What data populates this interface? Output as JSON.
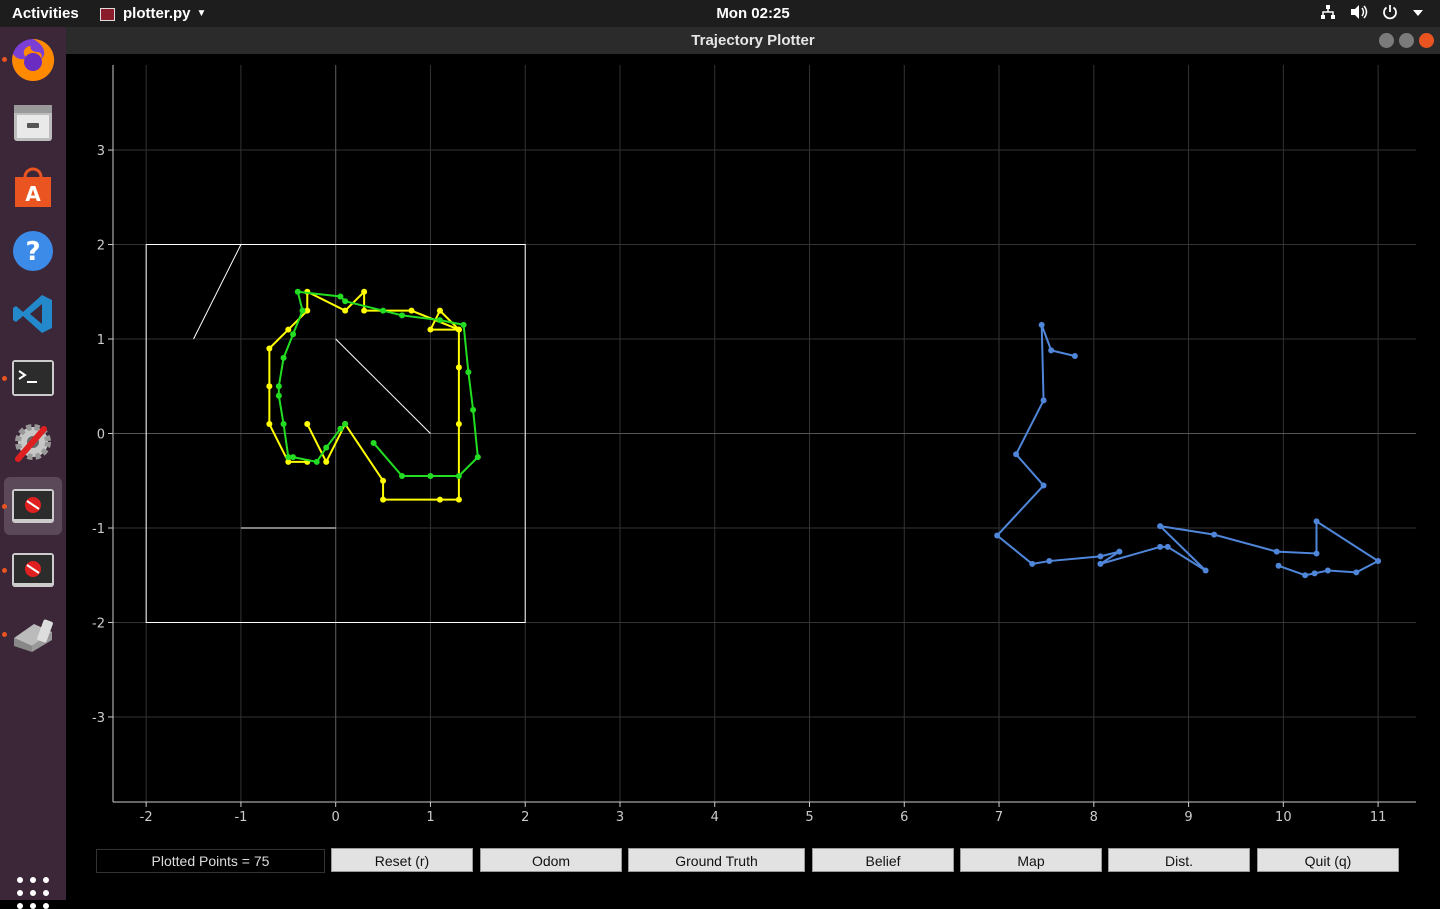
{
  "topbar": {
    "activities": "Activities",
    "app_name": "plotter.py",
    "clock": "Mon 02:25"
  },
  "dock": {
    "items": [
      {
        "name": "firefox-icon",
        "running": true
      },
      {
        "name": "files-icon",
        "running": false
      },
      {
        "name": "software-center-icon",
        "running": false
      },
      {
        "name": "help-icon",
        "running": false
      },
      {
        "name": "vscode-icon",
        "running": false
      },
      {
        "name": "terminal-icon",
        "running": true
      },
      {
        "name": "system-tools-icon",
        "running": false
      },
      {
        "name": "plotter-window-icon",
        "running": true,
        "active": true
      },
      {
        "name": "plotter-window-2-icon",
        "running": true
      },
      {
        "name": "scanner-icon",
        "running": true
      }
    ]
  },
  "window": {
    "title": "Trajectory Plotter"
  },
  "status": {
    "plotted_points": "Plotted Points = 75"
  },
  "buttons": {
    "reset": "Reset (r)",
    "odom": "Odom",
    "ground_truth": "Ground Truth",
    "belief": "Belief",
    "map": "Map",
    "dist": "Dist.",
    "quit": "Quit (q)"
  },
  "chart_data": {
    "type": "line",
    "title": "",
    "xlabel": "",
    "ylabel": "",
    "xlim": [
      -2.35,
      11.4
    ],
    "ylim": [
      -3.9,
      3.9
    ],
    "x_ticks": [
      -2,
      -1,
      0,
      1,
      2,
      3,
      4,
      5,
      6,
      7,
      8,
      9,
      10,
      11
    ],
    "y_ticks": [
      -3,
      -2,
      -1,
      0,
      1,
      2,
      3
    ],
    "grid": true,
    "colors": {
      "map": "#ffffff",
      "yellow": "#ffff00",
      "green": "#22dd22",
      "blue": "#4f86d9",
      "grid": "#333333"
    },
    "map_box": {
      "x": [
        -2,
        2,
        2,
        -2,
        -2
      ],
      "y": [
        2,
        2,
        -2,
        -2,
        2
      ]
    },
    "map_lines": [
      {
        "x": [
          -1.5,
          -1.0
        ],
        "y": [
          1.0,
          2.0
        ]
      },
      {
        "x": [
          0,
          1.0
        ],
        "y": [
          1.0,
          0.0
        ]
      },
      {
        "x": [
          -1.0,
          0
        ],
        "y": [
          -1.0,
          -1.0
        ]
      }
    ],
    "series": [
      {
        "color": "yellow",
        "x": [
          -0.3,
          -0.1,
          0.1,
          0.5,
          0.5,
          1.1,
          1.3,
          1.3,
          1.3,
          1.3,
          1.1,
          1.0,
          1.3,
          0.8,
          0.3,
          0.3,
          0.1,
          -0.3,
          -0.3,
          -0.5,
          -0.7,
          -0.7,
          -0.7,
          -0.5,
          -0.3
        ],
        "y": [
          0.1,
          -0.3,
          0.1,
          -0.5,
          -0.7,
          -0.7,
          -0.7,
          0.1,
          0.7,
          1.1,
          1.3,
          1.1,
          1.1,
          1.3,
          1.3,
          1.5,
          1.3,
          1.5,
          1.3,
          1.1,
          0.9,
          0.5,
          0.1,
          -0.3,
          -0.3
        ]
      },
      {
        "color": "green",
        "x": [
          0.4,
          0.7,
          1.0,
          1.3,
          1.5,
          1.45,
          1.4,
          1.35,
          1.1,
          0.7,
          0.5,
          0.1,
          0.05,
          -0.4,
          -0.35,
          -0.45,
          -0.55,
          -0.6,
          -0.6,
          -0.55,
          -0.5,
          -0.45,
          -0.2,
          -0.1,
          0.05,
          0.1
        ],
        "y": [
          -0.1,
          -0.45,
          -0.45,
          -0.45,
          -0.25,
          0.25,
          0.65,
          1.15,
          1.2,
          1.25,
          1.3,
          1.4,
          1.45,
          1.5,
          1.3,
          1.05,
          0.8,
          0.5,
          0.4,
          0.1,
          -0.25,
          -0.25,
          -0.3,
          -0.15,
          0.05,
          0.1
        ]
      },
      {
        "color": "blue",
        "x": [
          7.8,
          7.55,
          7.45,
          7.47,
          7.18,
          7.47,
          6.98,
          7.35,
          7.53,
          8.07,
          8.27,
          8.07,
          8.7,
          8.78,
          9.18,
          8.7,
          9.27,
          9.93,
          10.35,
          10.35,
          11.0,
          10.77,
          10.47,
          10.33,
          10.23,
          9.95
        ],
        "y": [
          0.82,
          0.88,
          1.15,
          0.35,
          -0.22,
          -0.55,
          -1.08,
          -1.38,
          -1.35,
          -1.3,
          -1.25,
          -1.38,
          -1.2,
          -1.2,
          -1.45,
          -0.98,
          -1.07,
          -1.25,
          -1.27,
          -0.93,
          -1.35,
          -1.47,
          -1.45,
          -1.48,
          -1.5,
          -1.4
        ]
      }
    ]
  }
}
